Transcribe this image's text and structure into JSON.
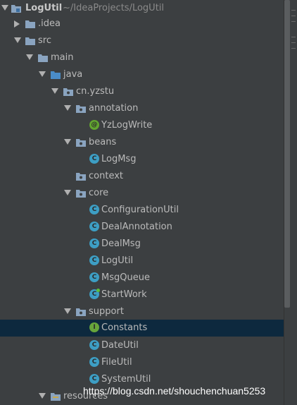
{
  "tree": {
    "root": {
      "label": "LogUtil",
      "path": "~/IdeaProjects/LogUtil"
    },
    "idea": "idea_label",
    "idea_label": ".idea",
    "src": "src",
    "main": "main",
    "java": "java",
    "package": "cn.yzstu",
    "annotation": {
      "label": "annotation",
      "items": [
        "YzLogWrite"
      ]
    },
    "beans": {
      "label": "beans",
      "items": [
        "LogMsg"
      ]
    },
    "context": "context",
    "core": {
      "label": "core",
      "items": [
        "ConfigurationUtil",
        "DealAnnotation",
        "DealMsg",
        "LogUtil",
        "MsgQueue",
        "StartWork"
      ]
    },
    "support": {
      "label": "support",
      "items": [
        "Constants",
        "DateUtil",
        "FileUtil",
        "SystemUtil"
      ]
    },
    "resources": "resources"
  },
  "icons": {
    "class_letter": "C",
    "annotation_letter": "@",
    "interface_letter": "I"
  },
  "colors": {
    "background": "#3c3f41",
    "selection": "#0d293e",
    "class_icon": "#3d9ec4",
    "annotation_icon": "#62a52f",
    "folder": "#8aa4c0"
  },
  "watermark": "https://blog.csdn.net/shouchenchuan5253"
}
